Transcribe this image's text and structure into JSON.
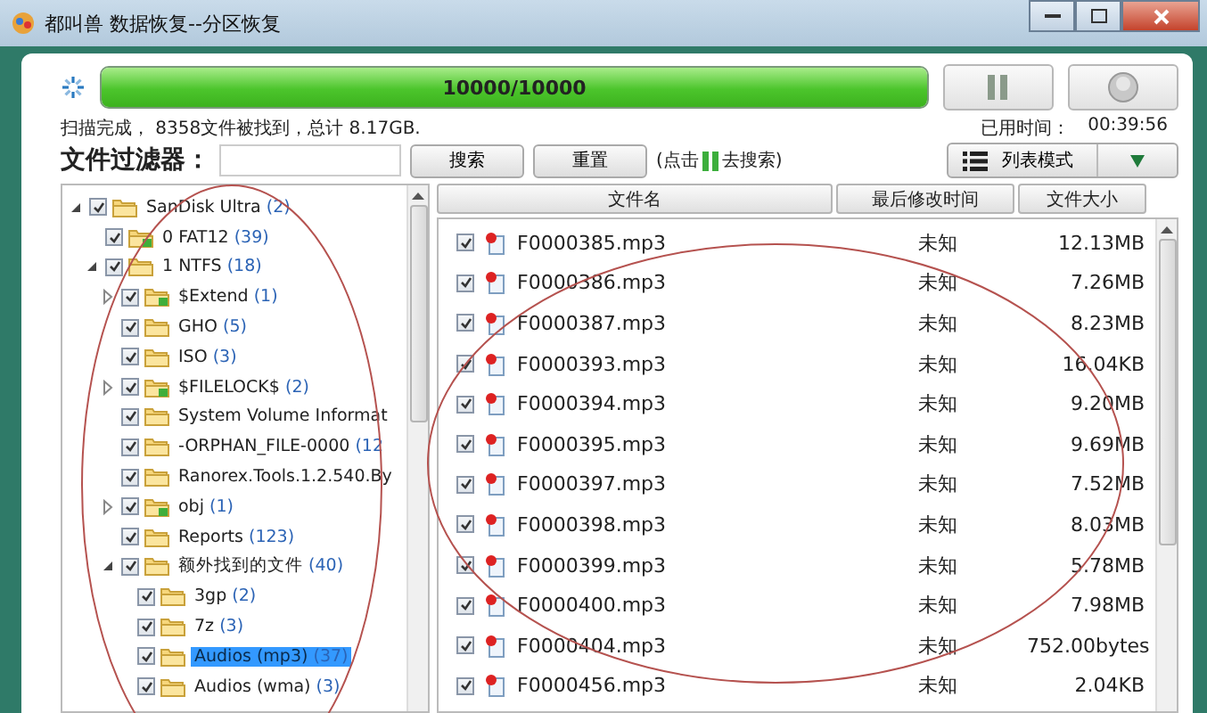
{
  "window": {
    "title": "都叫兽 数据恢复--分区恢复"
  },
  "progress": {
    "level": 1,
    "text": "10000/10000"
  },
  "status": {
    "summary": "扫描完成， 8358文件被找到，总计 8.17GB.",
    "elapsed_label": "已用时间：",
    "elapsed": "00:39:56"
  },
  "filter": {
    "label": "文件过滤器：",
    "search_button": "搜索",
    "reset_button": "重置",
    "hint_before": "(点击",
    "hint_after": "去搜索)"
  },
  "view_mode": {
    "label": "列表模式"
  },
  "tree": [
    {
      "label": "SanDisk Ultra",
      "count": "(2)",
      "kind": "folder",
      "checked": true,
      "selected": false,
      "expanded": true,
      "children": [
        {
          "label": "0 FAT12",
          "count": "(39)",
          "kind": "badge-folder",
          "checked": true,
          "selected": false
        },
        {
          "label": "1 NTFS",
          "count": "(18)",
          "kind": "folder",
          "checked": true,
          "selected": false,
          "expanded": true,
          "children": [
            {
              "label": "$Extend",
              "count": "(1)",
              "kind": "badge-folder",
              "checked": true,
              "selected": false,
              "expanded": false
            },
            {
              "label": "GHO",
              "count": "(5)",
              "kind": "folder",
              "checked": true,
              "selected": false
            },
            {
              "label": "ISO",
              "count": "(3)",
              "kind": "folder",
              "checked": true,
              "selected": false
            },
            {
              "label": "$FILELOCK$",
              "count": "(2)",
              "kind": "badge-folder",
              "checked": true,
              "selected": false,
              "expanded": false
            },
            {
              "label": "System Volume Informat",
              "kind": "folder",
              "checked": true,
              "selected": false
            },
            {
              "label": "-ORPHAN_FILE-0000",
              "count": "(12",
              "kind": "folder",
              "checked": true,
              "selected": false
            },
            {
              "label": "Ranorex.Tools.1.2.540.By",
              "kind": "folder",
              "checked": true,
              "selected": false
            },
            {
              "label": "obj",
              "count": "(1)",
              "kind": "badge-folder",
              "checked": true,
              "selected": false,
              "expanded": false
            },
            {
              "label": "Reports",
              "count": "(123)",
              "kind": "folder",
              "checked": true,
              "selected": false
            },
            {
              "label": "额外找到的文件",
              "count": "(40)",
              "kind": "folder",
              "checked": true,
              "selected": false,
              "expanded": true,
              "children": [
                {
                  "label": "3gp",
                  "count": "(2)",
                  "kind": "folder",
                  "checked": true,
                  "selected": false
                },
                {
                  "label": "7z",
                  "count": "(3)",
                  "kind": "folder",
                  "checked": true,
                  "selected": false
                },
                {
                  "label": "Audios (mp3)",
                  "count": "(37)",
                  "kind": "folder",
                  "checked": true,
                  "selected": true
                },
                {
                  "label": "Audios (wma)",
                  "count": "(3)",
                  "kind": "folder",
                  "checked": true,
                  "selected": false
                }
              ]
            }
          ]
        }
      ]
    }
  ],
  "table": {
    "columns": [
      "文件名",
      "最后修改时间",
      "文件大小"
    ],
    "rows": [
      {
        "name": "F0000385.mp3",
        "modified": "未知",
        "size": "12.13MB",
        "checked": true
      },
      {
        "name": "F0000386.mp3",
        "modified": "未知",
        "size": "7.26MB",
        "checked": true
      },
      {
        "name": "F0000387.mp3",
        "modified": "未知",
        "size": "8.23MB",
        "checked": true
      },
      {
        "name": "F0000393.mp3",
        "modified": "未知",
        "size": "16.04KB",
        "checked": true
      },
      {
        "name": "F0000394.mp3",
        "modified": "未知",
        "size": "9.20MB",
        "checked": true
      },
      {
        "name": "F0000395.mp3",
        "modified": "未知",
        "size": "9.69MB",
        "checked": true
      },
      {
        "name": "F0000397.mp3",
        "modified": "未知",
        "size": "7.52MB",
        "checked": true
      },
      {
        "name": "F0000398.mp3",
        "modified": "未知",
        "size": "8.03MB",
        "checked": true
      },
      {
        "name": "F0000399.mp3",
        "modified": "未知",
        "size": "5.78MB",
        "checked": true
      },
      {
        "name": "F0000400.mp3",
        "modified": "未知",
        "size": "7.98MB",
        "checked": true
      },
      {
        "name": "F0000404.mp3",
        "modified": "未知",
        "size": "752.00bytes",
        "checked": true
      },
      {
        "name": "F0000456.mp3",
        "modified": "未知",
        "size": "2.04KB",
        "checked": true
      }
    ]
  }
}
